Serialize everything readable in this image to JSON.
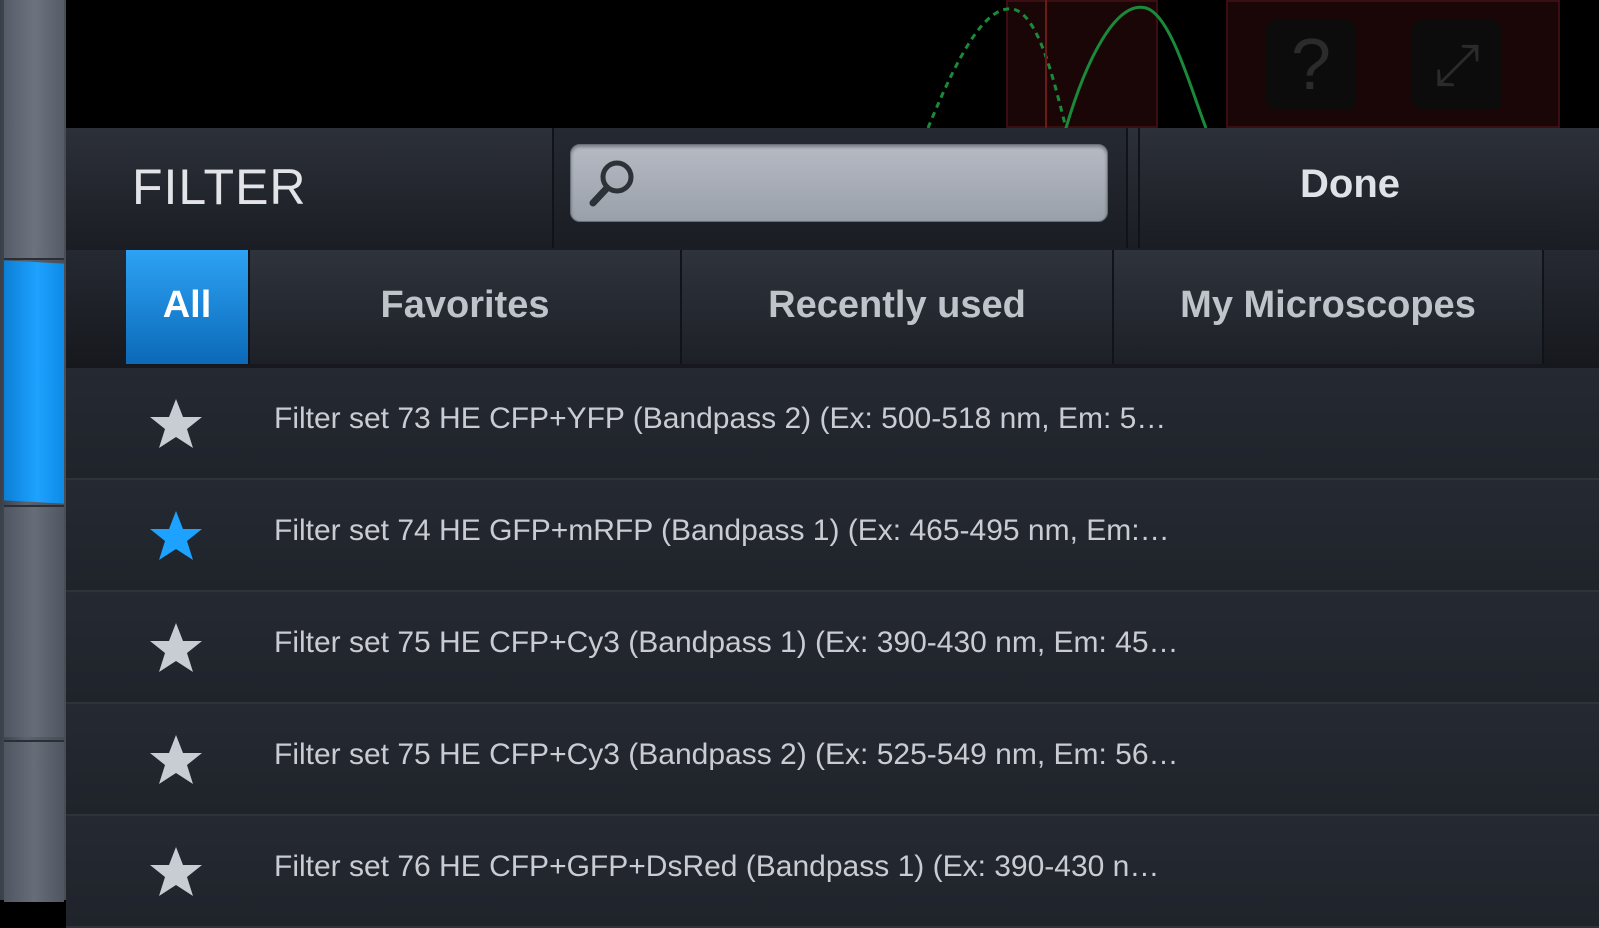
{
  "header": {
    "title": "FILTER",
    "done_label": "Done",
    "search": {
      "value": "",
      "placeholder": ""
    }
  },
  "tabs": [
    {
      "label": "All",
      "active": true
    },
    {
      "label": "Favorites",
      "active": false
    },
    {
      "label": "Recently used",
      "active": false
    },
    {
      "label": "My Microscopes",
      "active": false
    }
  ],
  "toolbar": {
    "help_glyph": "?",
    "expand_glyph": "⤢"
  },
  "filters": [
    {
      "text": "Filter set 73 HE CFP+YFP (Bandpass 2) (Ex: 500-518 nm, Em: 5…",
      "favorite": false
    },
    {
      "text": "Filter set 74 HE GFP+mRFP (Bandpass 1) (Ex: 465-495 nm, Em:…",
      "favorite": true
    },
    {
      "text": "Filter set 75 HE CFP+Cy3 (Bandpass 1) (Ex: 390-430 nm, Em: 45…",
      "favorite": false
    },
    {
      "text": "Filter set 75 HE CFP+Cy3 (Bandpass 2) (Ex: 525-549 nm, Em: 56…",
      "favorite": false
    },
    {
      "text": "Filter set 76 HE CFP+GFP+DsRed (Bandpass 1) (Ex: 390-430 n…",
      "favorite": false
    }
  ],
  "colors": {
    "accent": "#1ea2ff",
    "star_default": "#c8ccd3",
    "star_favorite": "#1ea2ff"
  }
}
